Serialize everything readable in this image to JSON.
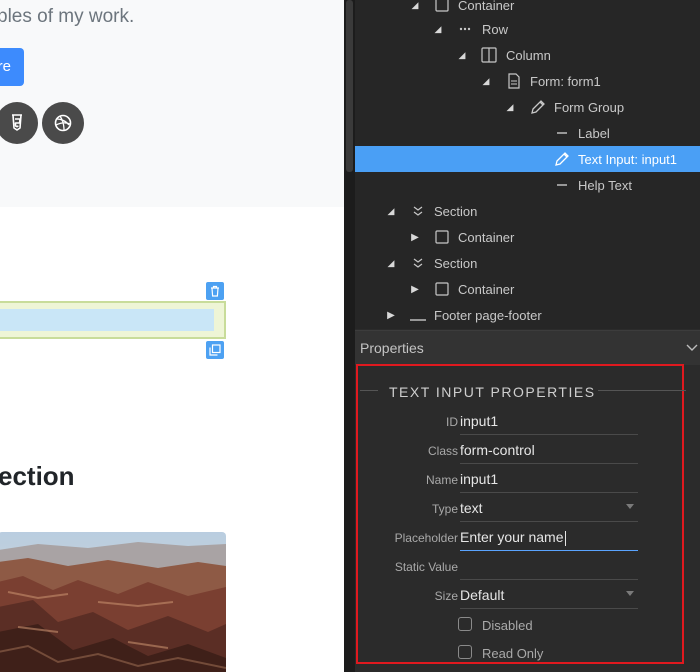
{
  "canvas": {
    "hero_text": "ples of my work.",
    "hero_button_label": "re",
    "section_heading": "ection"
  },
  "tree": {
    "rows": [
      {
        "label": "Container",
        "icon": "box-icon",
        "arrow": "expanded"
      },
      {
        "label": "Row",
        "icon": "dots-icon",
        "arrow": "expanded"
      },
      {
        "label": "Column",
        "icon": "column-icon",
        "arrow": "expanded"
      },
      {
        "label": "Form: form1",
        "icon": "file-icon",
        "arrow": "expanded"
      },
      {
        "label": "Form Group",
        "icon": "pencil-icon",
        "arrow": "expanded"
      },
      {
        "label": "Label",
        "icon": "dash-icon",
        "arrow": "none"
      },
      {
        "label": "Text Input: input1",
        "icon": "pencil-icon",
        "arrow": "none",
        "selected": true
      },
      {
        "label": "Help Text",
        "icon": "dash-icon",
        "arrow": "none"
      },
      {
        "label": "Section",
        "icon": "chevrons-icon",
        "arrow": "expanded"
      },
      {
        "label": "Container",
        "icon": "box-icon",
        "arrow": "collapsed"
      },
      {
        "label": "Section",
        "icon": "chevrons-icon",
        "arrow": "expanded"
      },
      {
        "label": "Container",
        "icon": "box-icon",
        "arrow": "collapsed"
      },
      {
        "label": "Footer page-footer",
        "icon": "footer-icon",
        "arrow": "collapsed"
      }
    ]
  },
  "properties": {
    "header": "Properties",
    "group_title": "TEXT INPUT PROPERTIES",
    "id_label": "ID",
    "id_value": "input1",
    "class_label": "Class",
    "class_value": "form-control",
    "name_label": "Name",
    "name_value": "input1",
    "type_label": "Type",
    "type_value": "text",
    "placeholder_label": "Placeholder",
    "placeholder_value": "Enter your name",
    "static_label": "Static Value",
    "static_value": "",
    "size_label": "Size",
    "size_value": "Default",
    "disabled_label": "Disabled",
    "disabled_checked": false,
    "readonly_label": "Read Only",
    "readonly_checked": false
  },
  "colors": {
    "selection": "#4a9ff5",
    "highlight_border": "#e0191f",
    "panel_bg": "#2b2b2b",
    "hero_button": "#3d8bfd"
  }
}
